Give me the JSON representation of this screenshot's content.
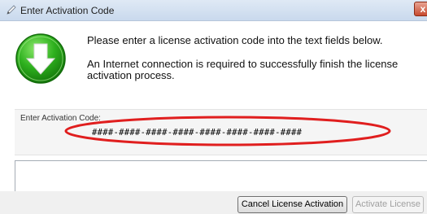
{
  "window": {
    "title": "Enter Activation Code",
    "close_label": "x",
    "title_icon": "pencil-icon"
  },
  "dialog": {
    "icon": "download-arrow-icon",
    "message_1": "Please enter a license activation code into the text fields below.",
    "message_2": "An Internet connection is required to successfully finish the license activation process."
  },
  "activation": {
    "label": "Enter Activation Code:",
    "code_value": "####-####-####-####-####-####-####-####",
    "highlight_color": "#e01e1e"
  },
  "buttons": {
    "cancel_label": "Cancel License Activation",
    "activate_label": "Activate License"
  }
}
